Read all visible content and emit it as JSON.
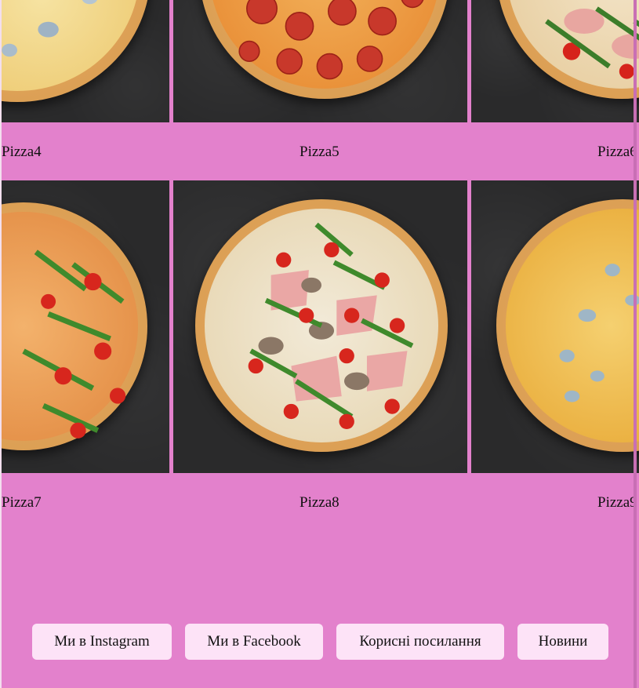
{
  "gallery": {
    "captions": {
      "pizza4": "Pizza4",
      "pizza5": "Pizza5",
      "pizza6": "Pizza6",
      "pizza7": "Pizza7",
      "pizza8": "Pizza8",
      "pizza9": "Pizza9"
    }
  },
  "footer": {
    "instagram": "Ми в Instagram",
    "facebook": "Ми в Facebook",
    "links": "Корисні посилання",
    "news": "Новини"
  },
  "colors": {
    "background": "#e381cc",
    "button": "#fde3f7",
    "photo_bg": "#2b2b2c"
  }
}
